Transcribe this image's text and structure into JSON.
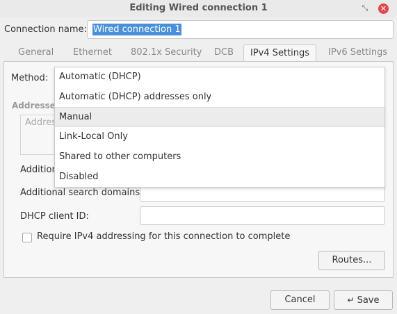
{
  "window": {
    "title": "Editing Wired connection 1",
    "restore_glyph": "⤡",
    "close_glyph": "✕"
  },
  "connection": {
    "label": "Connection name:",
    "value": "Wired connection 1"
  },
  "tabs": [
    {
      "label": "General"
    },
    {
      "label": "Ethernet"
    },
    {
      "label": "802.1x Security"
    },
    {
      "label": "DCB"
    },
    {
      "label": "IPv4 Settings"
    },
    {
      "label": "IPv6 Settings"
    }
  ],
  "active_tab": "IPv4 Settings",
  "ipv4": {
    "method_label": "Method:",
    "addresses_label": "Addresses",
    "addresses_placeholder": "Addres",
    "additional_dns_label": "Addition",
    "search_domains_label": "Additional search domains:",
    "search_domains_value": "",
    "dhcp_client_id_label": "DHCP client ID:",
    "dhcp_client_id_value": "",
    "require_ipv4_label": "Require IPv4 addressing for this connection to complete",
    "require_ipv4_checked": false,
    "routes_button": "Routes..."
  },
  "method_dropdown": {
    "options": [
      "Automatic (DHCP)",
      "Automatic (DHCP) addresses only",
      "Manual",
      "Link-Local Only",
      "Shared to other computers",
      "Disabled"
    ],
    "highlighted": "Manual"
  },
  "footer": {
    "cancel_label": "Cancel",
    "save_label": "Save",
    "save_icon": "↵"
  }
}
